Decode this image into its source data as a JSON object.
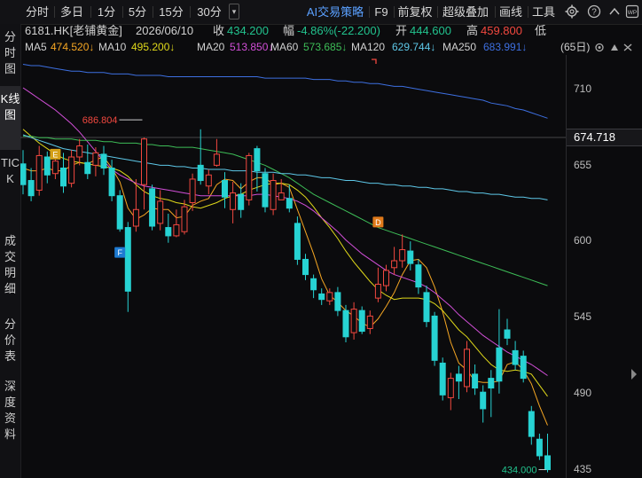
{
  "toolbar": {
    "periods": [
      "分时",
      "多日",
      "1分",
      "5分",
      "15分",
      "30分"
    ],
    "menu": [
      "AI交易策略",
      "F9",
      "前复权",
      "超级叠加",
      "画线",
      "工具"
    ]
  },
  "sidebar": {
    "tabs": [
      "分时图",
      "K线图",
      "TICK",
      "成交明细",
      "分价表",
      "深度资料"
    ]
  },
  "quote": {
    "code_name": "6181.HK[老铺黄金]",
    "date": "2026/06/10",
    "close_label": "收",
    "close": "434.200",
    "change_label": "幅",
    "change": "-4.86%(-22.200)",
    "open_label": "开",
    "open": "444.600",
    "high_label": "高",
    "high": "459.800",
    "low_label": "低"
  },
  "ma": {
    "ma5_label": "MA5",
    "ma5": "474.520↓",
    "ma10_label": "MA10",
    "ma10": "495.200↓",
    "ma20_label": "MA20",
    "ma20": "513.850↓",
    "ma60_label": "MA60",
    "ma60": "573.685↓",
    "ma120_label": "MA120",
    "ma120": "629.744↓",
    "ma250_label": "MA250",
    "ma250": "683.991↓",
    "period": "(65日)"
  },
  "colors": {
    "up": "#f2483f",
    "down": "#27d3d3",
    "ma5": "#f5a623",
    "ma10": "#e0d91a",
    "ma20": "#d24fd8",
    "ma60": "#3dbd57",
    "ma120": "#5ec8e8",
    "ma250": "#3d6fe0"
  },
  "chart_data": {
    "type": "candlestick",
    "price_ticks": [
      710,
      655,
      600,
      545,
      490,
      435
    ],
    "ylim": [
      428,
      735
    ],
    "current_price": "674.718",
    "annotations": {
      "high_label": "686.804",
      "low_label": "434.000",
      "markers": [
        "E",
        "F",
        "D"
      ]
    },
    "candles": [
      {
        "o": 655,
        "c": 640,
        "h": 665,
        "l": 633
      },
      {
        "o": 643,
        "c": 632,
        "h": 652,
        "l": 628
      },
      {
        "o": 636,
        "c": 661,
        "h": 668,
        "l": 632
      },
      {
        "o": 660,
        "c": 647,
        "h": 664,
        "l": 641
      },
      {
        "o": 648,
        "c": 657,
        "h": 664,
        "l": 644
      },
      {
        "o": 652,
        "c": 639,
        "h": 663,
        "l": 634
      },
      {
        "o": 641,
        "c": 660,
        "h": 665,
        "l": 638
      },
      {
        "o": 660,
        "c": 668,
        "h": 673,
        "l": 654
      },
      {
        "o": 656,
        "c": 648,
        "h": 669,
        "l": 644
      },
      {
        "o": 654,
        "c": 663,
        "h": 667,
        "l": 646
      },
      {
        "o": 662,
        "c": 652,
        "h": 668,
        "l": 647
      },
      {
        "o": 652,
        "c": 632,
        "h": 658,
        "l": 628
      },
      {
        "o": 632,
        "c": 608,
        "h": 636,
        "l": 606
      },
      {
        "o": 609,
        "c": 563,
        "h": 613,
        "l": 548
      },
      {
        "o": 610,
        "c": 622,
        "h": 644,
        "l": 606
      },
      {
        "o": 640,
        "c": 673,
        "h": 674,
        "l": 622
      },
      {
        "o": 637,
        "c": 610,
        "h": 640,
        "l": 607
      },
      {
        "o": 612,
        "c": 628,
        "h": 636,
        "l": 607
      },
      {
        "o": 609,
        "c": 603,
        "h": 619,
        "l": 598
      },
      {
        "o": 603,
        "c": 611,
        "h": 622,
        "l": 602
      },
      {
        "o": 606,
        "c": 624,
        "h": 629,
        "l": 604
      },
      {
        "o": 627,
        "c": 644,
        "h": 648,
        "l": 621
      },
      {
        "o": 654,
        "c": 643,
        "h": 680,
        "l": 640
      },
      {
        "o": 639,
        "c": 647,
        "h": 651,
        "l": 633
      },
      {
        "o": 654,
        "c": 662,
        "h": 673,
        "l": 653
      },
      {
        "o": 643,
        "c": 631,
        "h": 649,
        "l": 623
      },
      {
        "o": 622,
        "c": 634,
        "h": 642,
        "l": 612
      },
      {
        "o": 633,
        "c": 622,
        "h": 641,
        "l": 616
      },
      {
        "o": 629,
        "c": 661,
        "h": 663,
        "l": 625
      },
      {
        "o": 666,
        "c": 650,
        "h": 668,
        "l": 635
      },
      {
        "o": 648,
        "c": 624,
        "h": 652,
        "l": 620
      },
      {
        "o": 622,
        "c": 643,
        "h": 648,
        "l": 618
      },
      {
        "o": 629,
        "c": 634,
        "h": 644,
        "l": 629
      },
      {
        "o": 630,
        "c": 623,
        "h": 640,
        "l": 620
      },
      {
        "o": 612,
        "c": 586,
        "h": 617,
        "l": 582
      },
      {
        "o": 586,
        "c": 575,
        "h": 590,
        "l": 571
      },
      {
        "o": 572,
        "c": 564,
        "h": 575,
        "l": 558
      },
      {
        "o": 561,
        "c": 557,
        "h": 565,
        "l": 553
      },
      {
        "o": 556,
        "c": 562,
        "h": 565,
        "l": 553
      },
      {
        "o": 562,
        "c": 549,
        "h": 566,
        "l": 545
      },
      {
        "o": 549,
        "c": 530,
        "h": 553,
        "l": 526
      },
      {
        "o": 533,
        "c": 550,
        "h": 555,
        "l": 528
      },
      {
        "o": 549,
        "c": 534,
        "h": 552,
        "l": 532
      },
      {
        "o": 536,
        "c": 545,
        "h": 549,
        "l": 532
      },
      {
        "o": 558,
        "c": 568,
        "h": 580,
        "l": 555
      },
      {
        "o": 567,
        "c": 578,
        "h": 582,
        "l": 563
      },
      {
        "o": 580,
        "c": 585,
        "h": 595,
        "l": 575
      },
      {
        "o": 585,
        "c": 593,
        "h": 604,
        "l": 580
      },
      {
        "o": 592,
        "c": 583,
        "h": 599,
        "l": 578
      },
      {
        "o": 582,
        "c": 566,
        "h": 586,
        "l": 561
      },
      {
        "o": 562,
        "c": 541,
        "h": 567,
        "l": 537
      },
      {
        "o": 545,
        "c": 513,
        "h": 548,
        "l": 509
      },
      {
        "o": 511,
        "c": 488,
        "h": 515,
        "l": 484
      },
      {
        "o": 486,
        "c": 500,
        "h": 504,
        "l": 477
      },
      {
        "o": 503,
        "c": 498,
        "h": 509,
        "l": 485
      },
      {
        "o": 494,
        "c": 521,
        "h": 527,
        "l": 490
      },
      {
        "o": 503,
        "c": 493,
        "h": 510,
        "l": 488
      },
      {
        "o": 490,
        "c": 478,
        "h": 495,
        "l": 468
      },
      {
        "o": 500,
        "c": 493,
        "h": 506,
        "l": 472
      },
      {
        "o": 522,
        "c": 498,
        "h": 550,
        "l": 489
      },
      {
        "o": 535,
        "c": 529,
        "h": 543,
        "l": 524
      },
      {
        "o": 520,
        "c": 510,
        "h": 527,
        "l": 506
      },
      {
        "o": 516,
        "c": 500,
        "h": 520,
        "l": 497
      },
      {
        "o": 476,
        "c": 458,
        "h": 480,
        "l": 452
      },
      {
        "o": 456,
        "c": 444,
        "h": 460,
        "l": 441
      },
      {
        "o": 444,
        "c": 434,
        "h": 460,
        "l": 432
      }
    ],
    "ma_series": {
      "MA5": [
        652,
        650,
        650,
        652,
        650,
        650,
        654,
        656,
        655,
        658,
        660,
        652,
        642,
        623,
        615,
        618,
        623,
        622,
        622,
        616,
        617,
        625,
        628,
        630,
        640,
        644,
        643,
        637,
        642,
        645,
        645,
        640,
        641,
        638,
        622,
        606,
        590,
        572,
        560,
        555,
        549,
        545,
        540,
        537,
        543,
        552,
        562,
        575,
        585,
        586,
        580,
        566,
        548,
        526,
        511,
        506,
        498,
        497,
        497,
        498,
        510,
        512,
        506,
        496,
        480,
        466
      ],
      "MA10": [
        680,
        675,
        670,
        666,
        662,
        659,
        657,
        656,
        655,
        654,
        653,
        652,
        650,
        646,
        640,
        635,
        632,
        630,
        629,
        627,
        626,
        624,
        623,
        625,
        627,
        630,
        632,
        633,
        636,
        638,
        640,
        641,
        641,
        640,
        636,
        631,
        624,
        616,
        609,
        601,
        592,
        584,
        577,
        570,
        564,
        560,
        557,
        558,
        558,
        558,
        557,
        554,
        549,
        542,
        535,
        530,
        523,
        516,
        510,
        506,
        505,
        506,
        505,
        503,
        495,
        487
      ],
      "MA20": [
        710,
        706,
        702,
        698,
        694,
        689,
        684,
        678,
        671,
        664,
        657,
        651,
        647,
        644,
        641,
        639,
        638,
        637,
        636,
        635,
        634,
        633,
        632,
        632,
        632,
        632,
        632,
        632,
        632,
        633,
        633,
        632,
        631,
        630,
        628,
        625,
        621,
        616,
        611,
        606,
        600,
        595,
        590,
        586,
        582,
        578,
        575,
        573,
        571,
        569,
        566,
        562,
        557,
        552,
        546,
        541,
        536,
        531,
        527,
        523,
        519,
        516,
        513,
        510,
        506,
        502
      ],
      "MA60": [
        675,
        675,
        674,
        674,
        673,
        673,
        673,
        672,
        672,
        672,
        671,
        671,
        670,
        670,
        670,
        669,
        669,
        668,
        668,
        667,
        667,
        667,
        666,
        665,
        664,
        663,
        662,
        660,
        658,
        656,
        654,
        651,
        648,
        645,
        641,
        637,
        633,
        630,
        627,
        624,
        621,
        618,
        615,
        612,
        609,
        607,
        605,
        603,
        601,
        599,
        597,
        595,
        593,
        591,
        589,
        587,
        585,
        583,
        581,
        579,
        577,
        575,
        573,
        571,
        569,
        567
      ],
      "MA120": [
        676,
        674,
        672,
        670,
        668,
        666,
        665,
        664,
        663,
        662,
        661,
        660,
        659,
        658,
        657,
        656,
        655,
        654,
        654,
        653,
        653,
        652,
        652,
        651,
        651,
        651,
        650,
        650,
        650,
        649,
        649,
        649,
        648,
        648,
        647,
        647,
        646,
        645,
        645,
        644,
        643,
        643,
        642,
        641,
        641,
        640,
        640,
        639,
        639,
        638,
        638,
        637,
        637,
        636,
        635,
        635,
        634,
        634,
        633,
        633,
        632,
        631,
        631,
        630,
        630,
        629
      ],
      "MA250": [
        727,
        726,
        726,
        725,
        724,
        723,
        722,
        722,
        721,
        721,
        721,
        720,
        720,
        720,
        719,
        719,
        719,
        719,
        718,
        718,
        718,
        718,
        718,
        718,
        718,
        718,
        718,
        718,
        718,
        718,
        717,
        717,
        717,
        717,
        717,
        717,
        716,
        716,
        716,
        715,
        715,
        714,
        714,
        713,
        713,
        712,
        711,
        711,
        710,
        709,
        708,
        707,
        706,
        705,
        704,
        703,
        702,
        701,
        699,
        698,
        697,
        695,
        694,
        692,
        690,
        688
      ]
    }
  }
}
